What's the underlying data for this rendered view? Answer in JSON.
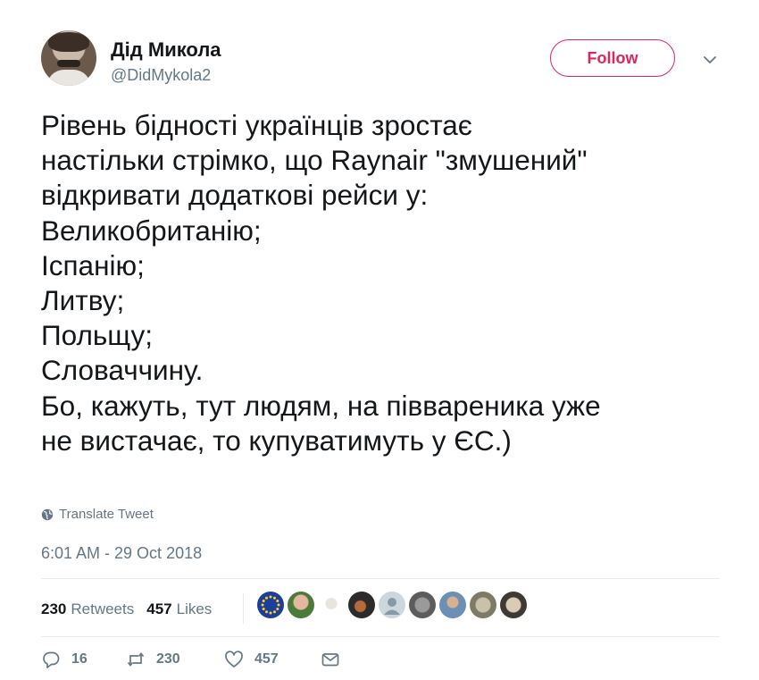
{
  "user": {
    "name": "Дід Микола",
    "handle": "@DidMykola2"
  },
  "follow_label": "Follow",
  "tweet": {
    "lines": [
      "Рівень бідності українців зростає",
      "настільки стрімко, що Raynair \"змушений\"",
      "відкривати додаткові рейси у:",
      "Великобританію;",
      "Іспанію;",
      "Литву;",
      "Польщу;",
      "Словаччину.",
      "Бо, кажуть, тут людям, на піввареника уже",
      "не вистачає, то купуватимуть у ЄС.)"
    ]
  },
  "translate_label": "Translate Tweet",
  "timestamp": "6:01 AM - 29 Oct 2018",
  "stats": {
    "retweets_count": "230",
    "retweets_label": "Retweets",
    "likes_count": "457",
    "likes_label": "Likes"
  },
  "actions": {
    "replies": "16",
    "retweets": "230",
    "likes": "457"
  },
  "colors": {
    "accent": "#e0245e",
    "muted": "#657786",
    "text": "#14171a"
  },
  "icons": [
    "chevron-down-icon",
    "globe-icon",
    "reply-icon",
    "retweet-icon",
    "heart-icon",
    "message-icon"
  ]
}
